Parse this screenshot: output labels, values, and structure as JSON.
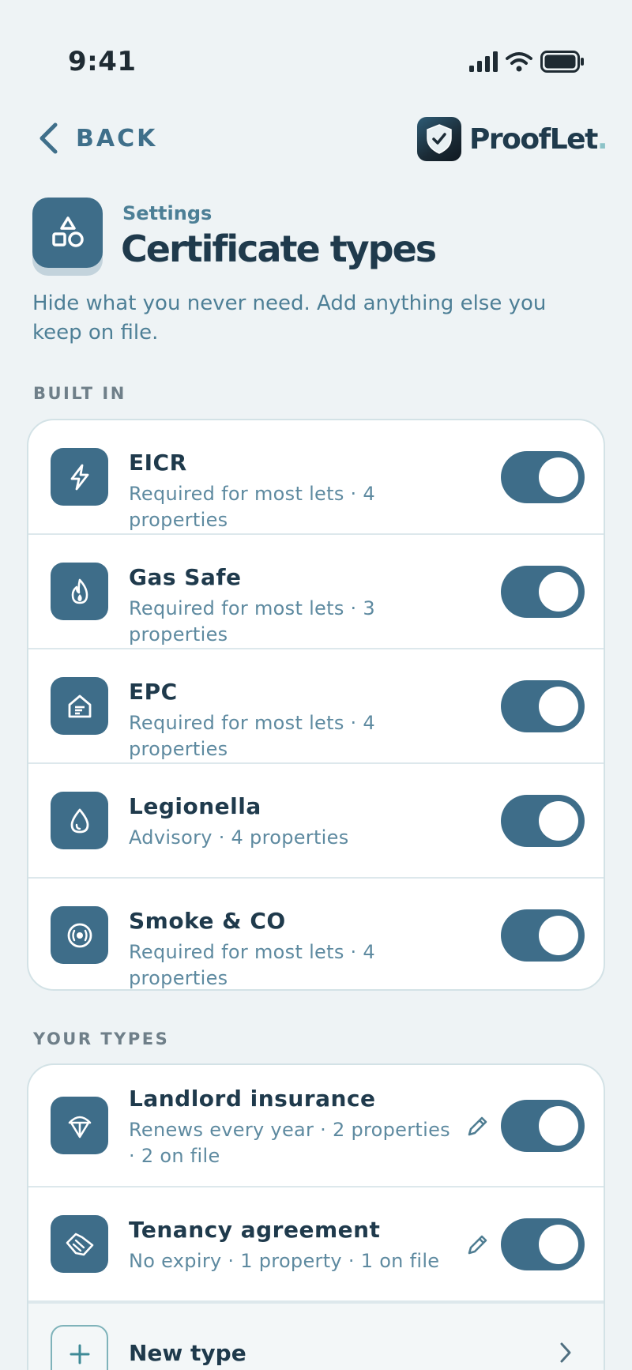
{
  "status_bar": {
    "time": "9:41"
  },
  "nav": {
    "back_label": "BACK",
    "brand_name": "ProofLet",
    "brand_dot": "."
  },
  "header": {
    "kicker": "Settings",
    "title": "Certificate types",
    "intro": "Hide what you never need. Add anything else you keep on file."
  },
  "built_in": {
    "label": "BUILT IN",
    "items": [
      {
        "name": "EICR",
        "sub": "Required for most lets · 4 properties",
        "icon": "lightning-icon",
        "enabled": true
      },
      {
        "name": "Gas Safe",
        "sub": "Required for most lets · 3 properties",
        "icon": "flame-icon",
        "enabled": true
      },
      {
        "name": "EPC",
        "sub": "Required for most lets · 4 properties",
        "icon": "house-rating-icon",
        "enabled": true
      },
      {
        "name": "Legionella",
        "sub": "Advisory · 4 properties",
        "icon": "droplet-icon",
        "enabled": true
      },
      {
        "name": "Smoke & CO",
        "sub": "Required for most lets · 4 properties",
        "icon": "alarm-icon",
        "enabled": true
      }
    ]
  },
  "your_types": {
    "label": "YOUR TYPES",
    "items": [
      {
        "name": "Landlord insurance",
        "sub": "Renews every year · 2 properties · 2 on file",
        "icon": "umbrella-icon",
        "enabled": true
      },
      {
        "name": "Tenancy agreement",
        "sub": "No expiry · 1 property · 1 on file",
        "icon": "handshake-icon",
        "enabled": true
      }
    ],
    "new_label": "New type"
  },
  "colors": {
    "accent": "#3e6d89",
    "background": "#eef3f5",
    "text": "#1f3a4c",
    "muted": "#5e8aa0"
  }
}
